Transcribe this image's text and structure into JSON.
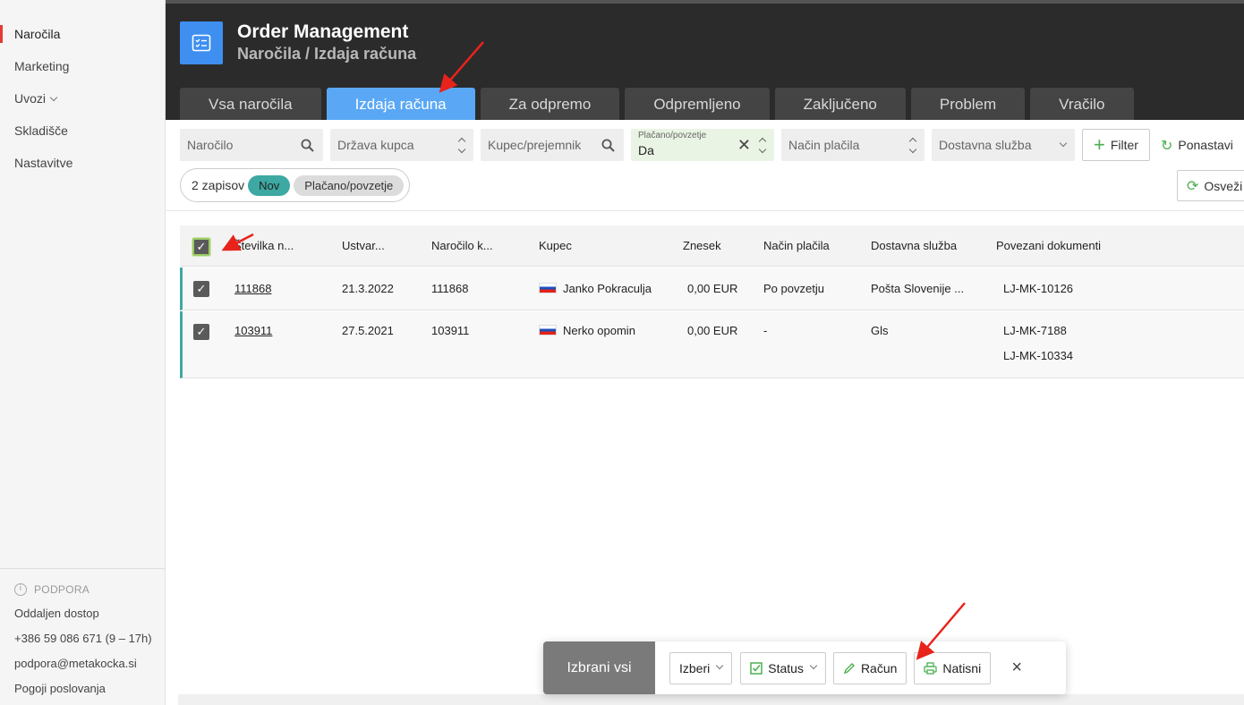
{
  "sidebar": {
    "items": [
      {
        "label": "Naročila",
        "active": true
      },
      {
        "label": "Marketing"
      },
      {
        "label": "Uvozi"
      },
      {
        "label": "Skladišče"
      },
      {
        "label": "Nastavitve"
      }
    ],
    "support_heading": "PODPORA",
    "support_items": [
      "Oddaljen dostop",
      "+386 59 086 671 (9 – 17h)",
      "podpora@metakocka.si",
      "Pogoji poslovanja"
    ]
  },
  "header": {
    "title": "Order Management",
    "subtitle": "Naročila / Izdaja računa",
    "tabs": [
      "Vsa naročila",
      "Izdaja računa",
      "Za odpremo",
      "Odpremljeno",
      "Zaključeno",
      "Problem",
      "Vračilo"
    ],
    "active_tab": "Izdaja računa"
  },
  "filters": {
    "order_placeholder": "Naročilo",
    "country_placeholder": "Država kupca",
    "customer_placeholder": "Kupec/prejemnik",
    "paid_label": "Plačano/povzetje",
    "paid_value": "Da",
    "payment_placeholder": "Način plačila",
    "delivery_placeholder": "Dostavna služba",
    "filter_label": "Filter",
    "reset_label": "Ponastavi",
    "refresh_label": "Osveži"
  },
  "summary": {
    "count_text": "2 zapisov",
    "badge_status": "Nov",
    "badge_paid": "Plačano/povzetje"
  },
  "table": {
    "columns": [
      "Številka n...",
      "Ustvar...",
      "Naročilo k...",
      "Kupec",
      "Znesek",
      "Način plačila",
      "Dostavna služba",
      "Povezani dokumenti"
    ],
    "rows": [
      {
        "number": "111868",
        "created": "21.3.2022",
        "order_ref": "111868",
        "customer": "Janko Pokraculja",
        "amount": "0,00 EUR",
        "payment": "Po povzetju",
        "delivery": "Pošta Slovenije ...",
        "docs": [
          "LJ-MK-10126"
        ]
      },
      {
        "number": "103911",
        "created": "27.5.2021",
        "order_ref": "103911",
        "customer": "Nerko opomin",
        "amount": "0,00 EUR",
        "payment": "-",
        "delivery": "Gls",
        "docs": [
          "LJ-MK-7188",
          "LJ-MK-10334"
        ]
      }
    ]
  },
  "actionbar": {
    "label": "Izbrani vsi",
    "select": "Izberi",
    "status": "Status",
    "invoice": "Račun",
    "print": "Natisni"
  },
  "colors": {
    "accent_tab": "#5aa8f5",
    "header_bg": "#2b2b2b",
    "teal": "#3ea8a3",
    "annotation_arrow": "#e8231b"
  }
}
